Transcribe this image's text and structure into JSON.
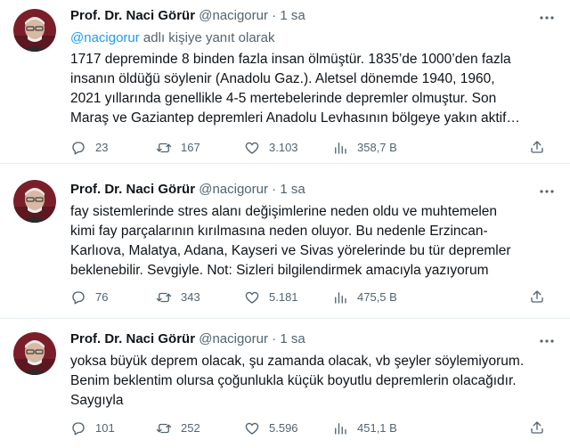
{
  "tweets": [
    {
      "author": {
        "name": "Prof. Dr. Naci Görür",
        "handle": "@nacigorur",
        "separator": "·",
        "time": "1 sa"
      },
      "reply_to": {
        "handle": "@nacigorur",
        "text": " adlı kişiye yanıt olarak"
      },
      "lines": [
        "1717 depreminde 8 binden fazla insan ölmüştür. 1835’de 1000’den fazla",
        "insanın öldüğü söylenir (Anadolu Gaz.). Aletsel dönemde 1940, 1960,",
        "2021 yıllarında genellikle 4-5 mertebelerinde depremler olmuştur. Son",
        "Maraş ve Gaziantep depremleri Anadolu Levhasının bölgeye yakın aktif…"
      ],
      "stats": {
        "replies": "23",
        "retweets": "167",
        "likes": "3.103",
        "views": "358,7 B"
      }
    },
    {
      "author": {
        "name": "Prof. Dr. Naci Görür",
        "handle": "@nacigorur",
        "separator": "·",
        "time": "1 sa"
      },
      "lines": [
        "fay sistemlerinde stres alanı değişimlerine neden oldu ve muhtemelen",
        "kimi fay parçalarının kırılmasına neden oluyor. Bu nedenle Erzincan-",
        "Karlıova, Malatya, Adana, Kayseri ve Sivas yörelerinde bu tür depremler",
        "beklenebilir. Sevgiyle. Not: Sizleri bilgilendirmek amacıyla yazıyorum"
      ],
      "stats": {
        "replies": "76",
        "retweets": "343",
        "likes": "5.181",
        "views": "475,5 B"
      }
    },
    {
      "author": {
        "name": "Prof. Dr. Naci Görür",
        "handle": "@nacigorur",
        "separator": "·",
        "time": "1 sa"
      },
      "lines": [
        "yoksa büyük deprem olacak, şu zamanda olacak, vb şeyler söylemiyorum.",
        "Benim beklentim olursa çoğunlukla küçük boyutlu depremlerin olacağıdır.",
        "Saygıyla"
      ],
      "stats": {
        "replies": "101",
        "retweets": "252",
        "likes": "5.596",
        "views": "451,1 B"
      }
    }
  ],
  "colors": {
    "text": "#0f1419",
    "secondary": "#536471",
    "link": "#1d9bf0",
    "divider": "#e6ecf0"
  },
  "icons": [
    "more-icon",
    "reply-icon",
    "retweet-icon",
    "like-icon",
    "views-icon",
    "share-icon"
  ]
}
